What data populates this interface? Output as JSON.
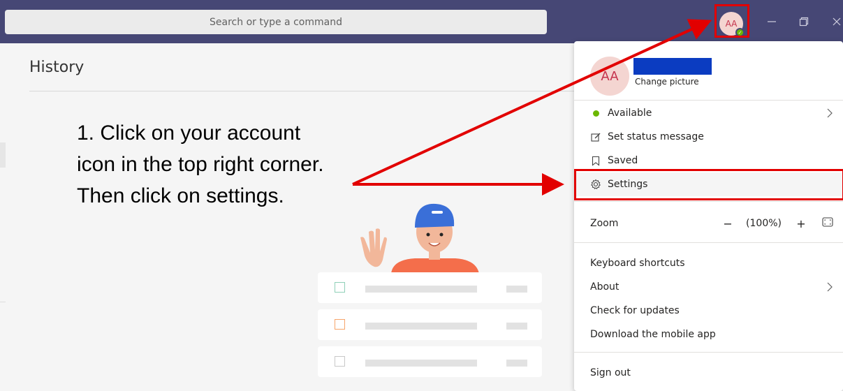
{
  "titlebar": {
    "search_placeholder": "Search or type a command",
    "avatar_initials": "AA",
    "bg_color": "#464775"
  },
  "history": {
    "title": "History"
  },
  "annotation": {
    "text": "1. Click on your account icon in the top right corner. Then click on settings.",
    "highlight_color": "#e20000"
  },
  "illustration": {
    "checkbox_colors": [
      "#8fd0b8",
      "#f6a56b",
      "#c8c8c8"
    ]
  },
  "account_menu": {
    "avatar_initials": "AA",
    "change_picture": "Change picture",
    "status": "Available",
    "status_color": "#6bb700",
    "set_status": "Set status message",
    "saved": "Saved",
    "settings": "Settings",
    "zoom_label": "Zoom",
    "zoom_minus": "−",
    "zoom_value": "(100%)",
    "zoom_plus": "+",
    "keyboard_shortcuts": "Keyboard shortcuts",
    "about": "About",
    "check_updates": "Check for updates",
    "mobile_app": "Download the mobile app",
    "sign_out": "Sign out"
  },
  "icons": {
    "status": "status-dot-icon",
    "set_status": "edit-status-icon",
    "saved": "bookmark-icon",
    "settings": "gear-icon",
    "chevron": "chevron-right-icon",
    "fit": "fit-to-screen-icon",
    "minimize": "minimize-icon",
    "restore": "restore-icon",
    "close": "close-icon"
  }
}
